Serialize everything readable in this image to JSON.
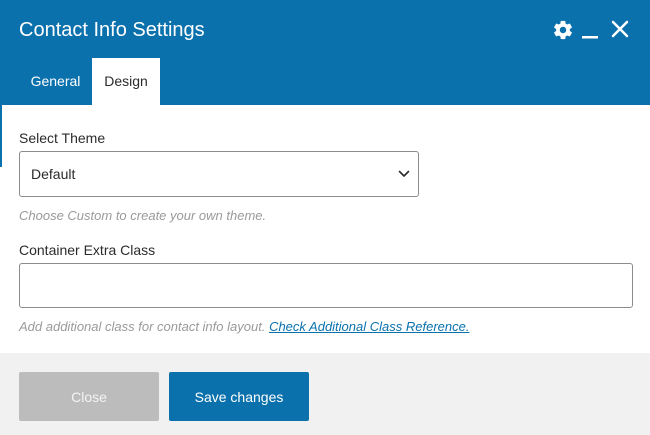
{
  "dialog": {
    "title": "Contact Info Settings",
    "icons": {
      "settings": "gear-icon",
      "minimize": "minimize-icon",
      "close": "close-icon"
    }
  },
  "tabs": [
    {
      "label": "General",
      "active": false
    },
    {
      "label": "Design",
      "active": true
    }
  ],
  "form": {
    "theme": {
      "label": "Select Theme",
      "selected": "Default",
      "hint": "Choose Custom to create your own theme."
    },
    "extra_class": {
      "label": "Container Extra Class",
      "value": "",
      "hint": "Add additional class for contact info layout.",
      "link": "Check Additional Class Reference."
    }
  },
  "footer": {
    "close_label": "Close",
    "save_label": "Save changes"
  },
  "colors": {
    "accent": "#0a71ad",
    "header_text": "#ffffff",
    "disabled_button": "#bcbcbc",
    "footer_bg": "#f1f1f1"
  }
}
